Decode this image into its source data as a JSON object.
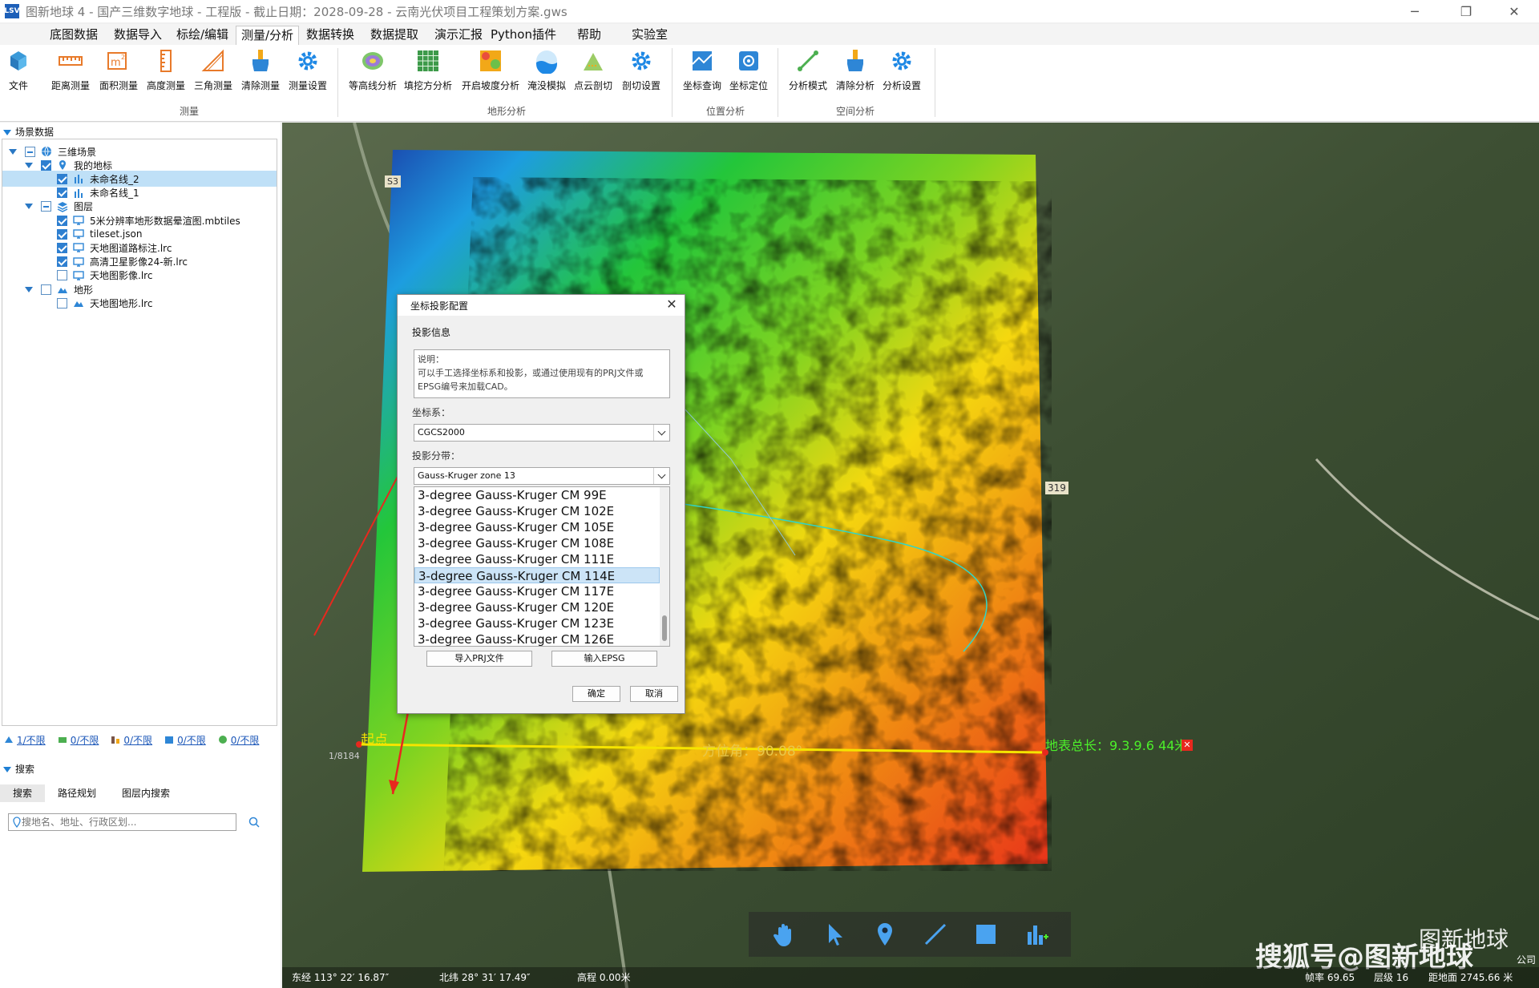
{
  "window": {
    "title": "图新地球 4 - 国产三维数字地球 - 工程版 - 截止日期：2028-09-28 - 云南光伏项目工程策划方案.gws",
    "logo_text": "LSV",
    "min_glyph": "─",
    "max_glyph": "❐",
    "close_glyph": "✕"
  },
  "menu": {
    "tabs": [
      "底图数据",
      "数据导入",
      "标绘/编辑",
      "测量/分析",
      "数据转换",
      "数据提取",
      "演示汇报",
      "Python插件",
      "帮助",
      "实验室"
    ],
    "active_index": 3
  },
  "ribbon": {
    "file_label": "文件",
    "groups": [
      {
        "label": "测量",
        "buttons": [
          "距离测量",
          "面积测量",
          "高度测量",
          "三角测量",
          "清除测量",
          "测量设置"
        ]
      },
      {
        "label": "地形分析",
        "buttons": [
          "等高线分析",
          "填挖方分析",
          "开启坡度分析",
          "淹没模拟",
          "点云剖切",
          "剖切设置"
        ]
      },
      {
        "label": "位置分析",
        "buttons": [
          "坐标查询",
          "坐标定位"
        ]
      },
      {
        "label": "空间分析",
        "buttons": [
          "分析模式",
          "清除分析",
          "分析设置"
        ]
      }
    ]
  },
  "left_panel": {
    "scene_header": "场景数据",
    "tree": [
      {
        "label": "三维场景",
        "level": 0,
        "expand": true,
        "check": "partial",
        "icon": "globe-icon"
      },
      {
        "label": "我的地标",
        "level": 1,
        "expand": true,
        "check": "checked",
        "icon": "pin-icon"
      },
      {
        "label": "未命名线_2",
        "level": 2,
        "expand": false,
        "check": "checked",
        "icon": "chart-icon",
        "selected": true
      },
      {
        "label": "未命名线_1",
        "level": 2,
        "expand": false,
        "check": "checked",
        "icon": "chart-icon"
      },
      {
        "label": "图层",
        "level": 1,
        "expand": true,
        "check": "partial",
        "icon": "layers-icon"
      },
      {
        "label": "5米分辨率地形数据晕渲图.mbtiles",
        "level": 2,
        "expand": false,
        "check": "checked",
        "icon": "monitor-icon"
      },
      {
        "label": "tileset.json",
        "level": 2,
        "expand": false,
        "check": "checked",
        "icon": "monitor-icon"
      },
      {
        "label": "天地图道路标注.lrc",
        "level": 2,
        "expand": false,
        "check": "checked",
        "icon": "monitor-icon"
      },
      {
        "label": "高清卫星影像24-新.lrc",
        "level": 2,
        "expand": false,
        "check": "checked",
        "icon": "monitor-icon"
      },
      {
        "label": "天地图影像.lrc",
        "level": 2,
        "expand": false,
        "check": "unchecked",
        "icon": "monitor-icon"
      },
      {
        "label": "地形",
        "level": 1,
        "expand": true,
        "check": "unchecked",
        "icon": "terrain-icon"
      },
      {
        "label": "天地图地形.lrc",
        "level": 2,
        "expand": false,
        "check": "unchecked",
        "icon": "terrain-icon"
      }
    ],
    "stats": [
      "1/不限",
      "0/不限",
      "0/不限",
      "0/不限",
      "0/不限"
    ],
    "search_header": "搜索",
    "search_tabs": [
      "搜索",
      "路径规划",
      "图层内搜索"
    ],
    "search_placeholder": "搜地名、地址、行政区划..."
  },
  "dialog": {
    "title": "坐标投影配置",
    "close_glyph": "✕",
    "section": "投影信息",
    "desc_lines": [
      "说明：",
      "可以手工选择坐标系和投影，或通过使用现有的PRJ文件或",
      "EPSG编号来加载CAD。"
    ],
    "crs_label": "坐标系：",
    "crs_value": "CGCS2000",
    "zone_label": "投影分带：",
    "zone_value": "Gauss-Kruger zone 13",
    "zone_options": [
      "3-degree Gauss-Kruger CM 99E",
      "3-degree Gauss-Kruger CM 102E",
      "3-degree Gauss-Kruger CM 105E",
      "3-degree Gauss-Kruger CM 108E",
      "3-degree Gauss-Kruger CM 111E",
      "3-degree Gauss-Kruger CM 114E",
      "3-degree Gauss-Kruger CM 117E",
      "3-degree Gauss-Kruger CM 120E",
      "3-degree Gauss-Kruger CM 123E",
      "3-degree Gauss-Kruger CM 126E"
    ],
    "selected_index": 5,
    "import_prj": "导入PRJ文件",
    "input_epsg": "输入EPSG",
    "ok": "确定",
    "cancel": "取消"
  },
  "map": {
    "start_label": "起点",
    "bearing_label": "方位角：90.08°",
    "length_label": "地表总长：9.3.9.6 44米",
    "road_label": "319",
    "road_label2": "S3",
    "scale_text": "1/8184",
    "status": {
      "lon": "东经 113° 22′ 16.87″",
      "lat": "北纬 28° 31′ 17.49″",
      "elev": "高程 0.00米",
      "fps": "帧率 69.65",
      "level": "层级 16",
      "dist": "距地面 2745.66 米"
    },
    "watermark": "搜狐号@图新地球",
    "watermark2": "图新地球",
    "watermark3": "公司",
    "colors": {
      "measure_line": "#f5e400",
      "profile_line": "#2fd6c8",
      "arrow": "#e8281e"
    }
  }
}
